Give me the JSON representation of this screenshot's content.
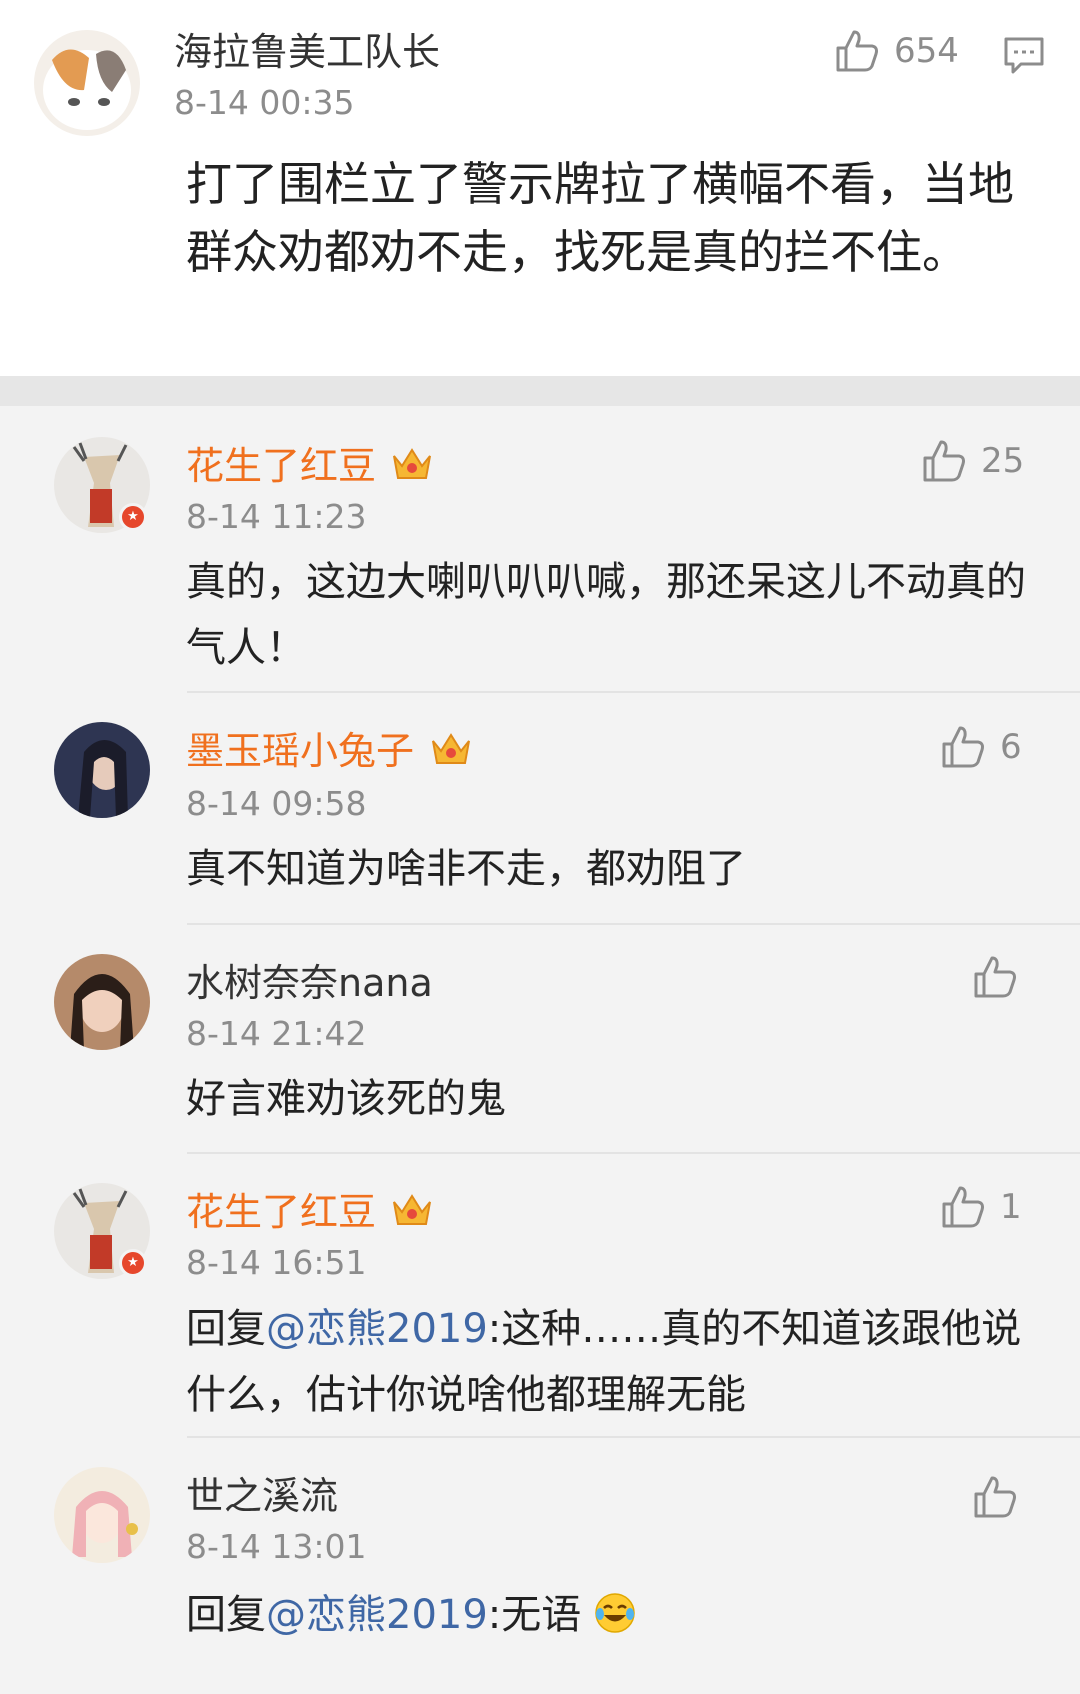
{
  "main_comment": {
    "username": "海拉鲁美工队长",
    "time": "8-14 00:35",
    "likes": "654",
    "text": "打了围栏立了警示牌拉了横幅不看，当地群众劝都劝不走，找死是真的拦不住。",
    "like_icon": "thumbs-up-icon",
    "reply_icon": "comment-bubble-icon"
  },
  "replies": [
    {
      "username": "花生了红豆",
      "vip": true,
      "time": "8-14 11:23",
      "likes": "25",
      "text": "真的，这边大喇叭叭叭喊，那还呆这儿不动真的气人！"
    },
    {
      "username": "墨玉瑶小兔子",
      "vip": true,
      "time": "8-14 09:58",
      "likes": "6",
      "text": "真不知道为啥非不走，都劝阻了"
    },
    {
      "username": "水树奈奈nana",
      "vip": false,
      "time": "8-14 21:42",
      "likes": "",
      "text": "好言难劝该死的鬼"
    },
    {
      "username": "花生了红豆",
      "vip": true,
      "time": "8-14 16:51",
      "likes": "1",
      "reply_prefix": "回复",
      "mention": "@恋熊2019",
      "text": ":这种……真的不知道该跟他说什么，估计你说啥他都理解无能"
    },
    {
      "username": "世之溪流",
      "vip": false,
      "time": "8-14 13:01",
      "likes": "",
      "reply_prefix": "回复",
      "mention": "@恋熊2019",
      "text": ":无语",
      "emoji": "laughing-tears-emoji"
    }
  ],
  "colors": {
    "vip_name": "#f0701e",
    "mention": "#3f67a5",
    "meta": "#8c8c8c"
  }
}
